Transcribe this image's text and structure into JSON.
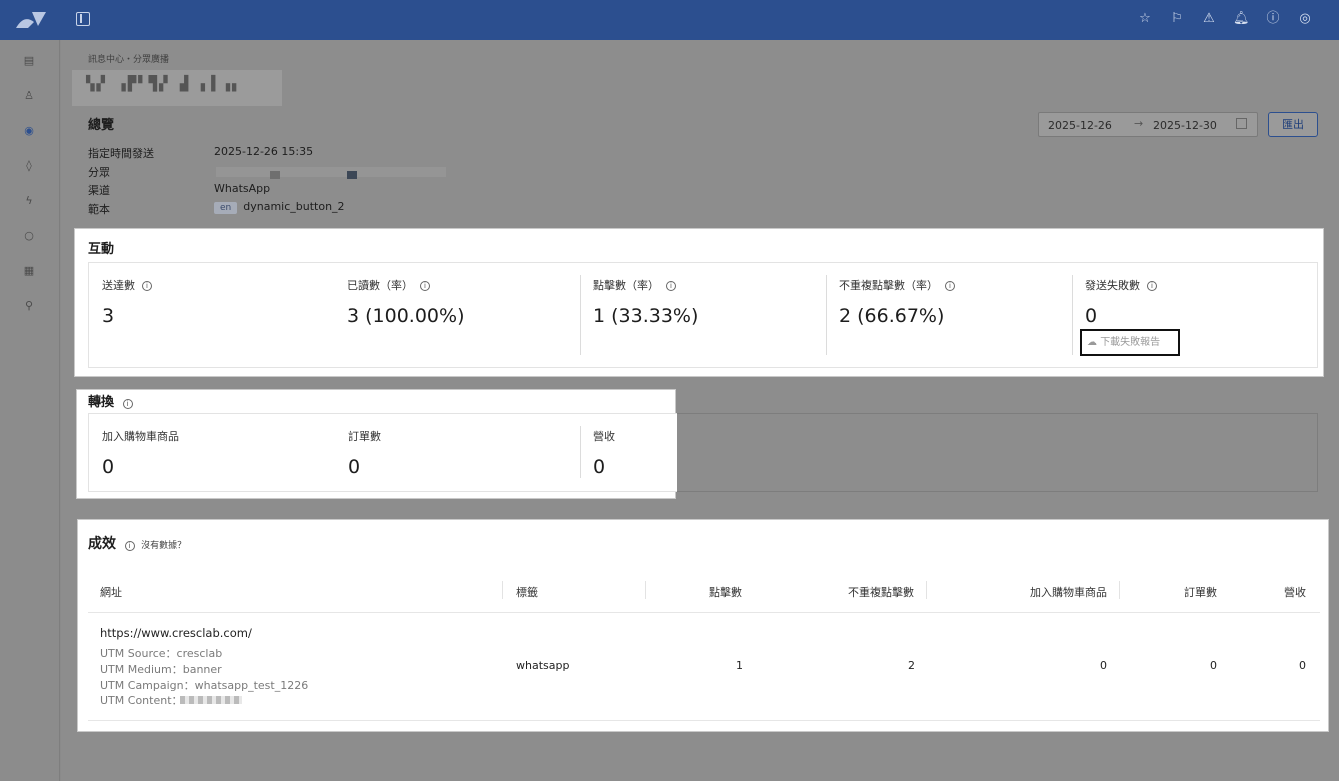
{
  "header": {
    "icons": [
      "star-icon",
      "flag-icon",
      "warning-icon",
      "bell-icon",
      "help-icon",
      "account-icon"
    ]
  },
  "sidebar": {
    "icons": [
      "dashboard-icon",
      "contacts-icon",
      "broadcast-icon",
      "campaign-icon",
      "automation-icon",
      "chat-icon",
      "report-icon",
      "integration-icon"
    ]
  },
  "breadcrumb": "訊息中心・分眾廣播",
  "overview": {
    "title": "總覽",
    "rows": [
      {
        "label": "指定時間發送",
        "value": "2025-12-26 15:35"
      },
      {
        "label": "分眾",
        "value": ""
      },
      {
        "label": "渠道",
        "value": "WhatsApp"
      },
      {
        "label": "範本",
        "value": "dynamic_button_2",
        "tag": "en"
      }
    ]
  },
  "date_range": {
    "start": "2025-12-26",
    "arrow": "→",
    "end": "2025-12-30"
  },
  "export_label": "匯出",
  "interaction": {
    "title": "互動",
    "stats": [
      {
        "label": "送達數",
        "value": "3"
      },
      {
        "label": "已讀數（率）",
        "value": "3 (100.00%)"
      },
      {
        "label": "點擊數（率）",
        "value": "1 (33.33%)"
      },
      {
        "label": "不重複點擊數（率）",
        "value": "2 (66.67%)"
      },
      {
        "label": "發送失敗數",
        "value": "0"
      }
    ],
    "download_label": "下載失敗報告"
  },
  "conversion": {
    "title": "轉換",
    "stats": [
      {
        "label": "加入購物車商品",
        "value": "0"
      },
      {
        "label": "訂單數",
        "value": "0"
      },
      {
        "label": "營收",
        "value": "0"
      }
    ]
  },
  "performance": {
    "title": "成效",
    "no_data": "沒有數據？",
    "columns": [
      "網址",
      "標籤",
      "點擊數",
      "不重複點擊數",
      "加入購物車商品",
      "訂單數",
      "營收"
    ],
    "rows": [
      {
        "url": "https://www.cresclab.com/",
        "utm_source": "UTM Source：cresclab",
        "utm_medium": "UTM Medium：banner",
        "utm_campaign": "UTM Campaign：whatsapp_test_1226",
        "utm_content": "UTM Content：",
        "tag": "whatsapp",
        "clicks": "1",
        "unique_clicks": "2",
        "add_to_cart": "0",
        "orders": "0",
        "revenue": "0"
      }
    ]
  }
}
